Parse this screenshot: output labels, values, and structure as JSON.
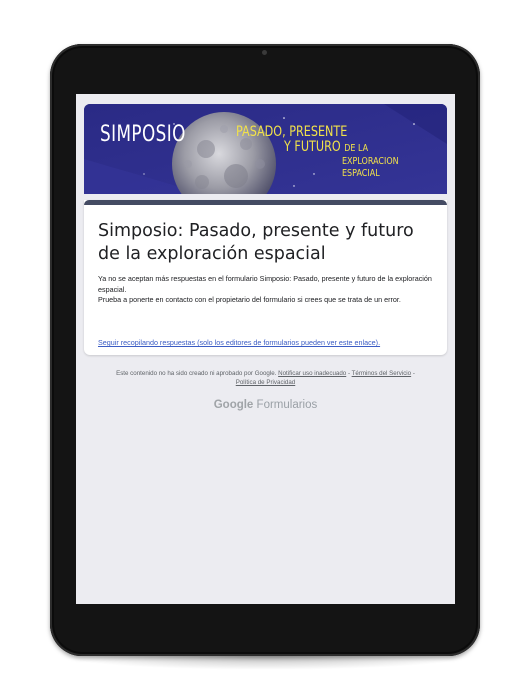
{
  "banner": {
    "simposio": "SIMPOSIO",
    "line1": "PASADO, PRESENTE",
    "line2_a": "Y FUTURO",
    "line2_b": "DE LA",
    "line3": "EXPLORACION",
    "line4": "ESPACIAL"
  },
  "form": {
    "title": "Simposio: Pasado, presente y futuro de la exploración espacial",
    "message_line1": "Ya no se aceptan más respuestas en el formulario Simposio: Pasado, presente y futuro de la exploración espacial.",
    "message_line2": "Prueba a ponerte en contacto con el propietario del formulario si crees que se trata de un error.",
    "link": "Seguir recopilando respuestas (solo los editores de formularios pueden ver este enlace)."
  },
  "footer": {
    "disclaimer": "Este contenido no ha sido creado ni aprobado por Google.",
    "report_link": "Notificar uso inadecuado",
    "sep1": " - ",
    "terms_link": "Términos del Servicio",
    "sep2": " - ",
    "privacy_link": "Política de Privacidad"
  },
  "brand": {
    "google": "Google",
    "product": "Formularios"
  },
  "colors": {
    "banner_bg": "#2c2c86",
    "banner_text_yellow": "#f2e24a",
    "card_top_bar": "#444b63",
    "link_blue": "#3b5cc4"
  }
}
